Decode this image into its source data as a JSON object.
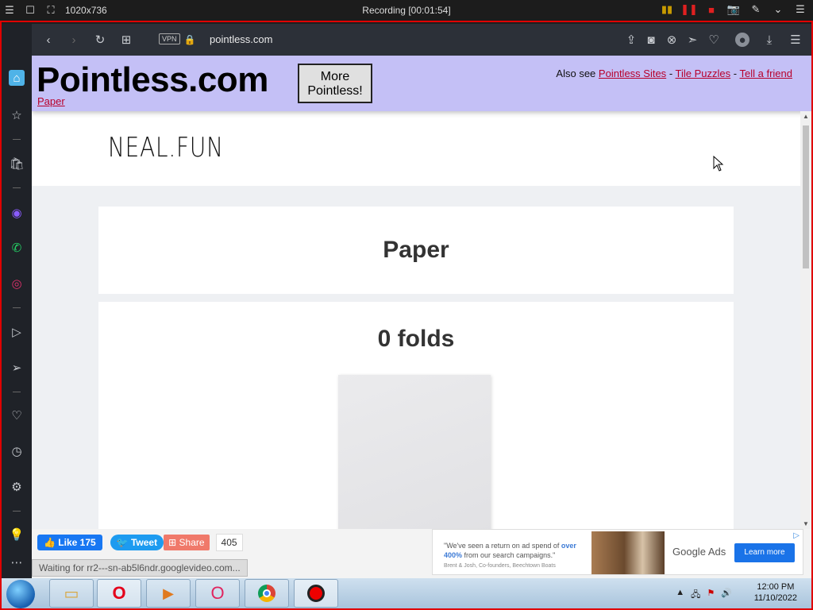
{
  "recorder": {
    "dimensions": "1020x736",
    "title": "Recording [00:01:54]"
  },
  "browser": {
    "vpn_label": "VPN",
    "url": "pointless.com"
  },
  "site": {
    "title": "Pointless.com",
    "current_page": "Paper",
    "more_button": "More Pointless!",
    "also_see_label": "Also see",
    "links": [
      "Pointless Sites",
      "Tile Puzzles",
      "Tell a friend"
    ],
    "separator": "-"
  },
  "embed": {
    "logo": "NEAL.FUN",
    "heading": "Paper",
    "fold_count_text": "0 folds"
  },
  "social": {
    "like_label": "Like",
    "like_count": "175",
    "tweet_label": "Tweet",
    "share_label": "Share",
    "share_count": "405"
  },
  "status_bar": "Waiting for rr2---sn-ab5l6ndr.googlevideo.com...",
  "ad": {
    "text_pre": "\"We've seen a return on ad spend of",
    "text_highlight": "over 400%",
    "text_post": "from our search campaigns.\"",
    "attribution": "Brent & Josh, Co-founders, Beechtown Boats",
    "brand": "Google Ads",
    "cta": "Learn more"
  },
  "taskbar": {
    "time": "12:00 PM",
    "date": "11/10/2022"
  }
}
